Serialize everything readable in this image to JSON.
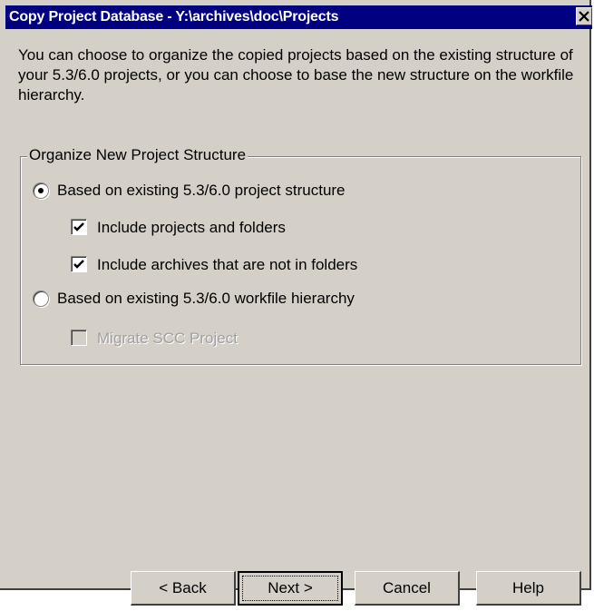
{
  "window": {
    "title": "Copy Project Database - Y:\\archives\\doc\\Projects",
    "close_glyph": "✕"
  },
  "intro": {
    "text": "You can choose to organize the copied projects based on the existing structure of your 5.3/6.0 projects, or you can choose to base the new structure on the workfile hierarchy."
  },
  "group": {
    "legend": "Organize New Project Structure",
    "radio_project": {
      "label": "Based on existing 5.3/6.0 project structure",
      "selected": true
    },
    "check_projects_folders": {
      "label": "Include projects and folders",
      "checked": true
    },
    "check_archives": {
      "label": "Include archives that are not in folders",
      "checked": true
    },
    "radio_workfile": {
      "label": "Based on existing 5.3/6.0 workfile hierarchy",
      "selected": false
    },
    "check_scc": {
      "label": "Migrate SCC Project",
      "checked": false,
      "enabled": false
    }
  },
  "buttons": {
    "back": "< Back",
    "next": "Next >",
    "cancel": "Cancel",
    "help": "Help"
  }
}
